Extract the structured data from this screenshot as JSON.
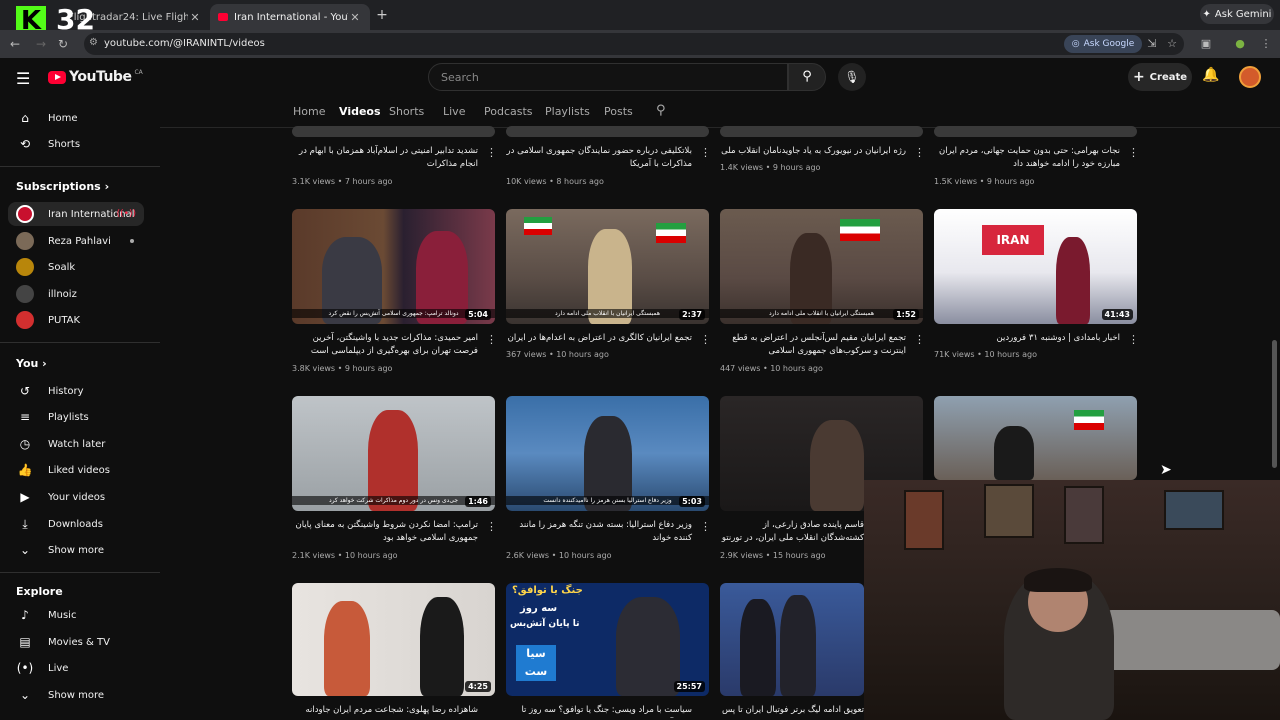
{
  "browser": {
    "tabs": [
      {
        "title": "Flightradar24: Live Flight Tra..."
      },
      {
        "title": "Iran International - YouTube"
      }
    ],
    "url": "youtube.com/@IRANINTL/videos",
    "ask_google": "Ask Google",
    "ask_gemini": "Ask Gemini",
    "new_tab": "+",
    "close": "✕"
  },
  "stream_overlay": {
    "logo": "K",
    "number": "32"
  },
  "youtube": {
    "logo": "YouTube",
    "region": "CA",
    "search_placeholder": "Search",
    "create_label": "Create"
  },
  "sidebar": {
    "top": [
      {
        "label": "Home",
        "icon": "home-icon"
      },
      {
        "label": "Shorts",
        "icon": "shorts-icon"
      }
    ],
    "subscriptions_heading": "Subscriptions",
    "subscriptions": [
      {
        "label": "Iran International",
        "color": "#c8102e",
        "selected": true,
        "live": true
      },
      {
        "label": "Reza Pahlavi",
        "color": "#7b6a58",
        "dot": true
      },
      {
        "label": "Soalk",
        "color": "#b8860b"
      },
      {
        "label": "illnoiz",
        "color": "#444"
      },
      {
        "label": "PUTAK",
        "color": "#d32f2f"
      }
    ],
    "you_heading": "You",
    "you": [
      {
        "label": "History",
        "icon": "history-icon"
      },
      {
        "label": "Playlists",
        "icon": "playlists-icon"
      },
      {
        "label": "Watch later",
        "icon": "watch-later-icon"
      },
      {
        "label": "Liked videos",
        "icon": "like-icon"
      },
      {
        "label": "Your videos",
        "icon": "your-videos-icon"
      },
      {
        "label": "Downloads",
        "icon": "download-icon"
      },
      {
        "label": "Show more",
        "icon": "chevron-down-icon"
      }
    ],
    "explore_heading": "Explore",
    "explore": [
      {
        "label": "Music",
        "icon": "music-icon"
      },
      {
        "label": "Movies & TV",
        "icon": "movies-icon"
      },
      {
        "label": "Live",
        "icon": "live-icon"
      },
      {
        "label": "Show more",
        "icon": "chevron-down-icon"
      }
    ]
  },
  "channel_tabs": [
    "Home",
    "Videos",
    "Shorts",
    "Live",
    "Podcasts",
    "Playlists",
    "Posts"
  ],
  "active_tab": "Videos",
  "videos": {
    "row1": [
      {
        "title": "تشدید تدابیر امنیتی در اسلام‌آباد همزمان با ابهام در انجام مذاکرات",
        "meta": "3.1K views • 7 hours ago"
      },
      {
        "title": "بلاتکلیفی درباره حضور نمایندگان جمهوری اسلامی در مذاکرات با آمریکا",
        "meta": "10K views • 8 hours ago"
      },
      {
        "title": "رژه ایرانیان در نیویورک به یاد جاویدنامان انقلاب ملی",
        "meta": "1.4K views • 9 hours ago"
      },
      {
        "title": "نجات بهرامی: حتی بدون حمایت جهانی، مردم ایران مبارزه خود را ادامه خواهند داد",
        "meta": "1.5K views • 9 hours ago"
      }
    ],
    "row2": [
      {
        "title": "امیر حمیدی: مذاکرات جدید با واشینگتن، آخرین فرصت تهران برای بهره‌گیری از دیپلماسی است",
        "meta": "3.8K views • 9 hours ago",
        "duration": "5:04",
        "caption": "دونالد ترامپ: جمهوری اسلامی آتش‌بس را نقض کرد"
      },
      {
        "title": "تجمع ایرانیان کالگری در اعتراض به اعدام‌ها در ایران",
        "meta": "367 views • 10 hours ago",
        "duration": "2:37",
        "caption": "همبستگی ایرانیان با انقلاب ملی ادامه دارد"
      },
      {
        "title": "تجمع ایرانیان مقیم لس‌آنجلس در اعتراض به قطع اینترنت و سرکوب‌های جمهوری اسلامی",
        "meta": "447 views • 10 hours ago",
        "duration": "1:52",
        "caption": "همبستگی ایرانیان با انقلاب ملی ادامه دارد"
      },
      {
        "title": "اخبار بامدادی | دوشنبه ۳۱ فروردین",
        "meta": "71K views • 10 hours ago",
        "duration": "41:43",
        "caption": ""
      }
    ],
    "row3": [
      {
        "title": "ترامپ: امضا نکردن شروط واشینگتن به معنای پایان جمهوری اسلامی خواهد بود",
        "meta": "2.1K views • 10 hours ago",
        "duration": "1:46",
        "caption": "جی‌دی ونس در دور دوم مذاکرات شرکت خواهد کرد"
      },
      {
        "title": "وزیر دفاع استرالیا: بسته شدن تنگه هرمز را مانند کننده خواند",
        "meta": "2.6K views • 10 hours ago",
        "duration": "5:03",
        "caption": "وزیر دفاع استرالیا بستن هرمز را ناامیدکننده دانست"
      },
      {
        "title": "قاسم پاینده صادق زارعی، از کشته‌شدگان انقلاب ملی ایران، در تورنتو",
        "meta": "2.9K views • 15 hours ago",
        "duration": "",
        "caption": ""
      },
      {
        "title": "",
        "meta": "",
        "duration": "",
        "caption": ""
      }
    ],
    "row4": [
      {
        "title": "شاهزاده رضا پهلوی: شجاعت مردم ایران جاودانه خواهد ماند",
        "duration": "4:25"
      },
      {
        "title": "سیاست با مراد ویسی: جنگ یا توافق؟ سه روز تا پایان آتش‌بس",
        "duration": "25:57",
        "overlay1": "جنگ یا توافق؟",
        "overlay2": "سه روز",
        "overlay3": "تا پایان آتش‌بس",
        "overlay4": "سیا ست"
      },
      {
        "title": "تعویق ادامه لیگ برتر فوتبال ایران تا پس از جام",
        "duration": ""
      }
    ]
  },
  "colors": {
    "accent": "#ff0033",
    "bg": "#0f0f0f",
    "kick": "#53fc18"
  }
}
